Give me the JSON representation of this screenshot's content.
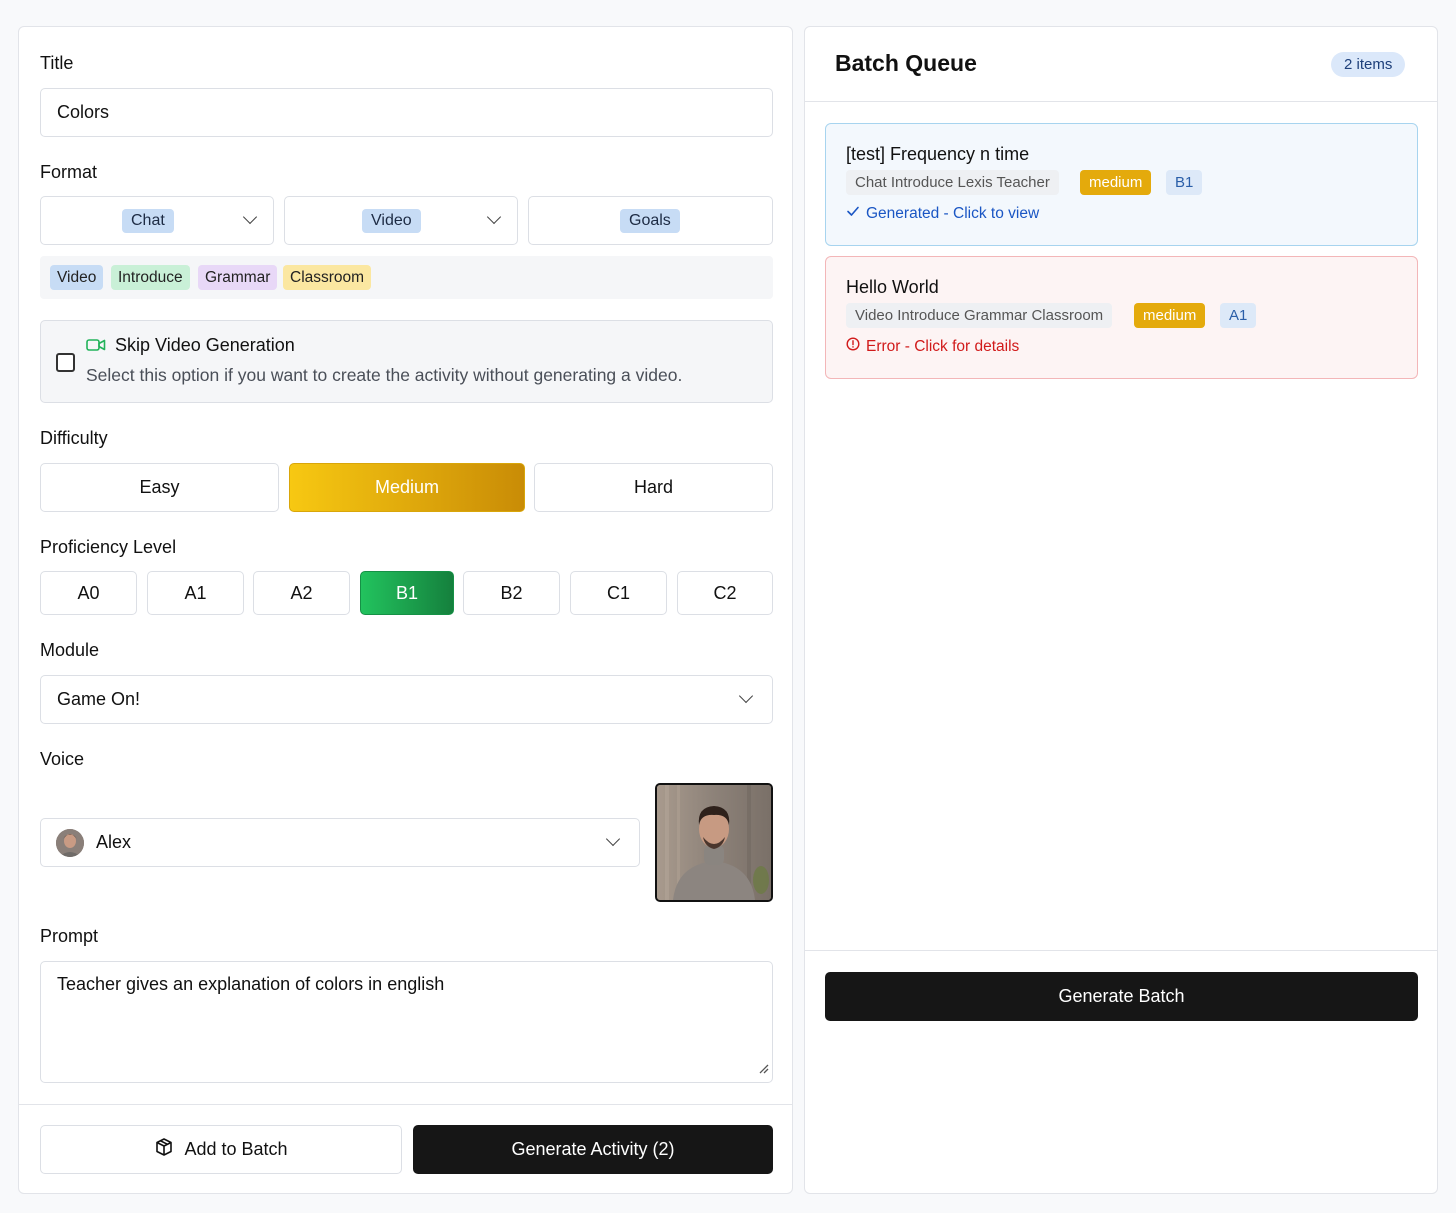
{
  "form": {
    "title_label": "Title",
    "title_value": "Colors",
    "format_label": "Format",
    "format_selects": [
      "Chat",
      "Video",
      "Goals"
    ],
    "tags": [
      "Video",
      "Introduce",
      "Grammar",
      "Classroom"
    ],
    "skip_video": {
      "title": "Skip Video Generation",
      "description": "Select this option if you want to create the activity without generating a video.",
      "checked": false
    },
    "difficulty_label": "Difficulty",
    "difficulty_options": [
      "Easy",
      "Medium",
      "Hard"
    ],
    "difficulty_selected": "Medium",
    "proficiency_label": "Proficiency Level",
    "proficiency_options": [
      "A0",
      "A1",
      "A2",
      "B1",
      "B2",
      "C1",
      "C2"
    ],
    "proficiency_selected": "B1",
    "module_label": "Module",
    "module_value": "Game On!",
    "voice_label": "Voice",
    "voice_value": "Alex",
    "prompt_label": "Prompt",
    "prompt_value": "Teacher gives an explanation of colors in english",
    "add_to_batch_label": "Add to Batch",
    "generate_activity_label": "Generate Activity (2)"
  },
  "queue": {
    "title": "Batch Queue",
    "count_badge": "2 items",
    "items": [
      {
        "title": "[test] Frequency n time",
        "format": "Chat Introduce Lexis Teacher",
        "difficulty": "medium",
        "level": "B1",
        "status": "Generated - Click to view"
      },
      {
        "title": "Hello World",
        "format": "Video Introduce Grammar Classroom",
        "difficulty": "medium",
        "level": "A1",
        "status": "Error - Click for details"
      }
    ],
    "generate_batch_label": "Generate Batch"
  },
  "colors": {
    "medium_gradient_start": "#f7c812",
    "medium_gradient_end": "#c98c06",
    "level_gradient_start": "#22c35e",
    "level_gradient_end": "#15803d",
    "success_text": "#1a56c4",
    "error_text": "#d11a1a",
    "primary_dark": "#161616"
  }
}
